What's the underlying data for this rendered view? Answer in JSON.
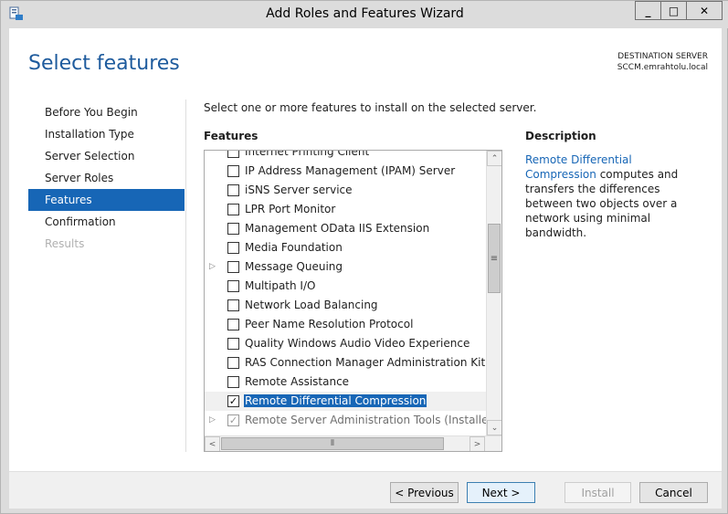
{
  "window": {
    "title": "Add Roles and Features Wizard",
    "min_glyph": "_",
    "max_glyph": "□",
    "close_glyph": "✕"
  },
  "header": {
    "page_title": "Select features",
    "destination_label": "DESTINATION SERVER",
    "destination_server": "SCCM.emrahtolu.local"
  },
  "nav": {
    "items": [
      {
        "label": "Before You Begin",
        "state": "normal"
      },
      {
        "label": "Installation Type",
        "state": "normal"
      },
      {
        "label": "Server Selection",
        "state": "normal"
      },
      {
        "label": "Server Roles",
        "state": "normal"
      },
      {
        "label": "Features",
        "state": "active"
      },
      {
        "label": "Confirmation",
        "state": "normal"
      },
      {
        "label": "Results",
        "state": "disabled"
      }
    ]
  },
  "main": {
    "instruction": "Select one or more features to install on the selected server.",
    "features_label": "Features",
    "features": [
      {
        "label": "Internet Printing Client",
        "checked": false,
        "expandable": false
      },
      {
        "label": "IP Address Management (IPAM) Server",
        "checked": false,
        "expandable": false
      },
      {
        "label": "iSNS Server service",
        "checked": false,
        "expandable": false
      },
      {
        "label": "LPR Port Monitor",
        "checked": false,
        "expandable": false
      },
      {
        "label": "Management OData IIS Extension",
        "checked": false,
        "expandable": false
      },
      {
        "label": "Media Foundation",
        "checked": false,
        "expandable": false
      },
      {
        "label": "Message Queuing",
        "checked": false,
        "expandable": true
      },
      {
        "label": "Multipath I/O",
        "checked": false,
        "expandable": false
      },
      {
        "label": "Network Load Balancing",
        "checked": false,
        "expandable": false
      },
      {
        "label": "Peer Name Resolution Protocol",
        "checked": false,
        "expandable": false
      },
      {
        "label": "Quality Windows Audio Video Experience",
        "checked": false,
        "expandable": false
      },
      {
        "label": "RAS Connection Manager Administration Kit (CMA",
        "checked": false,
        "expandable": false
      },
      {
        "label": "Remote Assistance",
        "checked": false,
        "expandable": false
      },
      {
        "label": "Remote Differential Compression",
        "checked": true,
        "expandable": false,
        "selected": true
      },
      {
        "label": "Remote Server Administration Tools (Installed)",
        "checked": true,
        "expandable": true,
        "installed": true
      }
    ],
    "scroll": {
      "up_glyph": "⌃",
      "down_glyph": "⌄",
      "left_glyph": "<",
      "right_glyph": ">",
      "vthumb_glyph": "≡",
      "hthumb_glyph": "⦀"
    }
  },
  "description": {
    "title": "Description",
    "link_text": "Remote Differential Compression",
    "body": " computes and transfers the differences between two objects over a network using minimal bandwidth."
  },
  "footer": {
    "previous_label": "< Previous",
    "next_label": "Next >",
    "install_label": "Install",
    "cancel_label": "Cancel"
  },
  "colors": {
    "accent": "#1766b6",
    "title_blue": "#1e5b9d"
  }
}
